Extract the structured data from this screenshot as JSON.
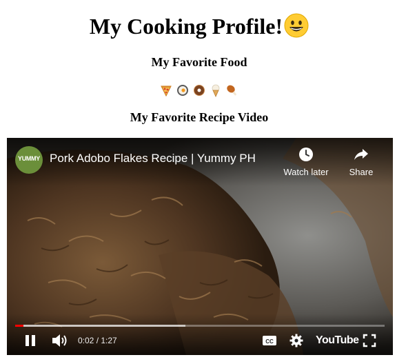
{
  "page": {
    "title": "My Cooking Profile!",
    "title_emoji": "grinning-face-emoji",
    "favorite_food_heading": "My Favorite Food",
    "food_emojis": [
      "pizza-emoji",
      "fried-egg-emoji",
      "doughnut-emoji",
      "ice-cream-emoji",
      "chicken-leg-emoji"
    ],
    "favorite_video_heading": "My Favorite Recipe Video"
  },
  "video": {
    "channel_logo_text": "YUMMY",
    "title": "Pork Adobo Flakes Recipe | Yummy PH",
    "watch_later_label": "Watch later",
    "share_label": "Share",
    "time_display": "0:02 / 1:27",
    "progress_fraction": 0.023,
    "buffered_fraction": 0.46,
    "brand": "YouTube",
    "colors": {
      "progress": "#ff0000",
      "overlay_text": "#ffffff"
    }
  }
}
